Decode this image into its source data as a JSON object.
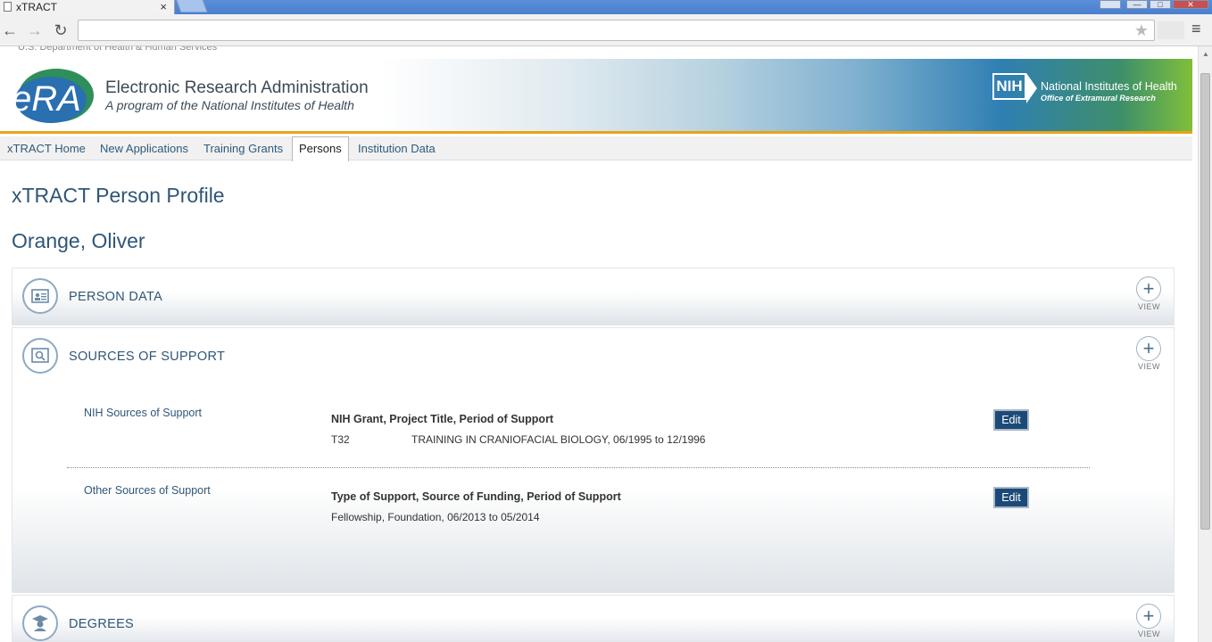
{
  "browser": {
    "tab_title": "xTRACT",
    "tab_close": "×",
    "address": "",
    "win_min": "—",
    "win_max": "□",
    "win_close": "✕",
    "back": "←",
    "forward": "→",
    "reload": "↻",
    "star": "★",
    "menu": "≡"
  },
  "header": {
    "hhs_text": "U.S. Department of Health & Human Services",
    "era_title": "Electronic Research Administration",
    "era_subtitle": "A program of the National Institutes of Health",
    "era_logo_text": "eRA",
    "nih_box": "NIH",
    "nih_name": "National Institutes of Health",
    "nih_office": "Office of  Extramural Research"
  },
  "nav": {
    "items": [
      "xTRACT Home",
      "New Applications",
      "Training Grants",
      "Persons",
      "Institution Data"
    ],
    "active": "Persons"
  },
  "page": {
    "title": "xTRACT Person Profile",
    "person_name": "Orange, Oliver"
  },
  "panels": {
    "person_data": {
      "title": "PERSON DATA",
      "view_label": "VIEW",
      "plus": "+"
    },
    "sources_of_support": {
      "title": "SOURCES OF SUPPORT",
      "view_label": "VIEW",
      "plus": "+",
      "nih": {
        "label": "NIH Sources of Support",
        "header": "NIH Grant,  Project Title,  Period of Support",
        "grant": "T32",
        "detail": "TRAINING IN CRANIOFACIAL BIOLOGY,  06/1995 to 12/1996",
        "edit": "Edit"
      },
      "other": {
        "label": "Other Sources of Support",
        "header": "Type of Support,  Source of Funding,  Period of Support",
        "detail": "Fellowship,  Foundation,  06/2013 to 05/2014",
        "edit": "Edit"
      }
    },
    "degrees": {
      "title": "DEGREES",
      "view_label": "VIEW",
      "plus": "+"
    }
  },
  "colors": {
    "link_blue": "#2f5678",
    "edit_button": "#1c4a78",
    "banner_accent": "#e8a317"
  }
}
